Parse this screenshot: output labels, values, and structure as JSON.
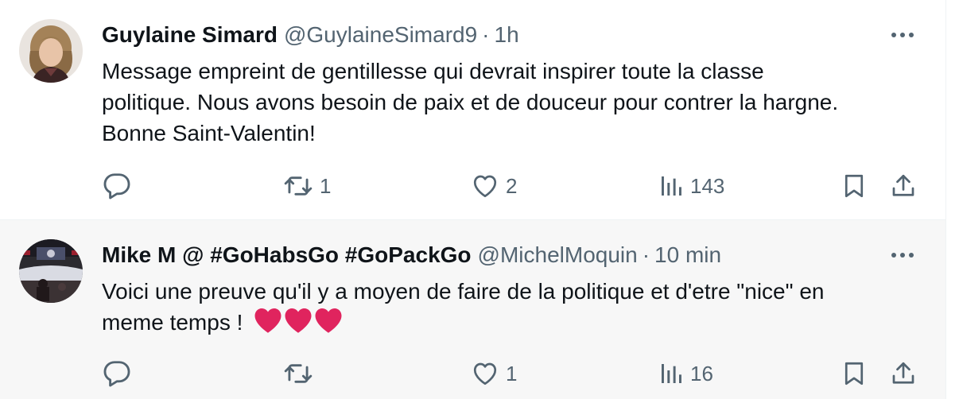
{
  "tweets": [
    {
      "name": "Guylaine Simard",
      "handle": "@GuylaineSimard9",
      "separator": "·",
      "time": "1h",
      "lines": [
        "Message empreint de gentillesse qui devrait inspirer toute la classe",
        "politique. Nous avons besoin de paix et de douceur pour contrer la hargne.",
        "Bonne Saint-Valentin!"
      ],
      "stats": {
        "replies": "",
        "reposts": "1",
        "likes": "2",
        "views": "143"
      }
    },
    {
      "name": "Mike M @ #GoHabsGo #GoPackGo",
      "handle": "@MichelMoquin",
      "separator": "·",
      "time": "10 min",
      "lines": [
        "Voici une preuve qu'il y a moyen de faire de la politique et d'etre \"nice\" en",
        "meme temps !"
      ],
      "emoji": [
        "red-heart",
        "red-heart",
        "red-heart"
      ],
      "stats": {
        "replies": "",
        "reposts": "",
        "likes": "1",
        "views": "16"
      }
    }
  ],
  "icons": [
    "reply-icon",
    "repost-icon",
    "like-icon",
    "views-icon",
    "bookmark-icon",
    "share-icon",
    "more-icon"
  ],
  "colors": {
    "text": "#0f1419",
    "secondary": "#536471",
    "heart": "#e0245e",
    "highlight_bg": "#f7f7f7"
  }
}
